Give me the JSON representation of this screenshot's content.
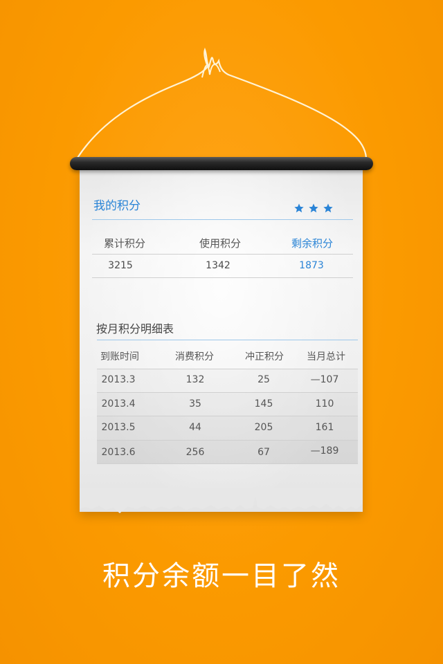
{
  "my_points": {
    "title": "我的积分",
    "rating_stars": 3,
    "summary": [
      {
        "label": "累计积分",
        "value": "3215",
        "highlight": false
      },
      {
        "label": "使用积分",
        "value": "1342",
        "highlight": false
      },
      {
        "label": "剩余积分",
        "value": "1873",
        "highlight": true
      }
    ]
  },
  "monthly": {
    "title": "按月积分明细表",
    "columns": [
      "到账时间",
      "消费积分",
      "冲正积分",
      "当月总计"
    ],
    "rows": [
      [
        "2013.3",
        "132",
        "25",
        "—107"
      ],
      [
        "2013.4",
        "35",
        "145",
        "110"
      ],
      [
        "2013.5",
        "44",
        "205",
        "161"
      ],
      [
        "2013.6",
        "256",
        "67",
        "—189"
      ]
    ]
  },
  "tagline": "积分余额一目了然",
  "colors": {
    "background": "#fb9a00",
    "accent": "#2a84d6",
    "text": "#555555",
    "tagline": "#ffffff"
  }
}
